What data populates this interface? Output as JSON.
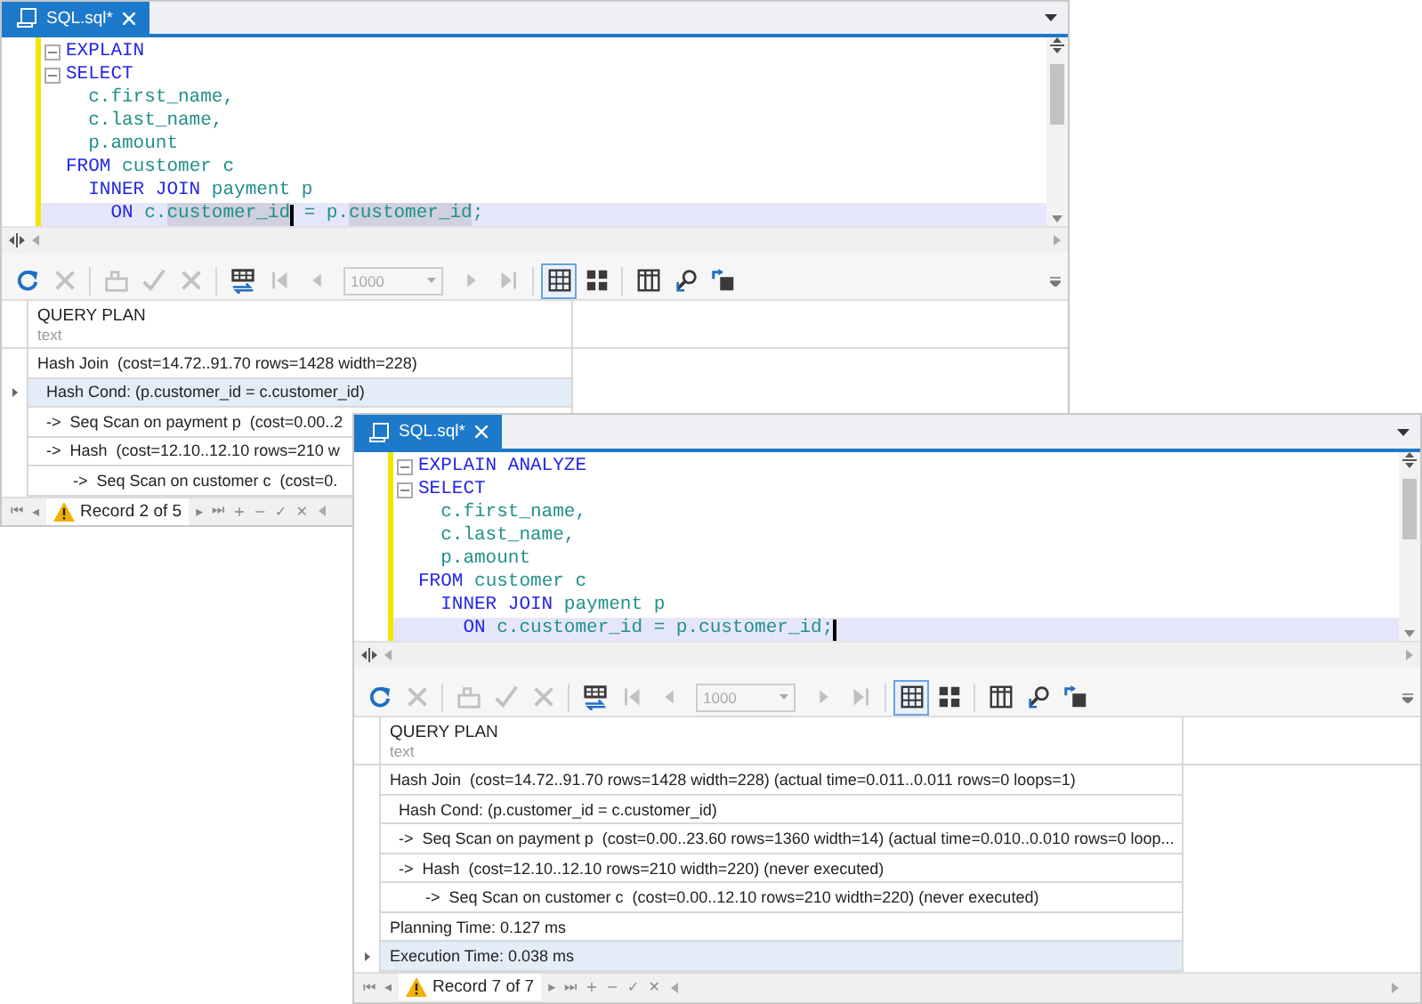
{
  "windows": [
    {
      "tab": {
        "title": "SQL.sql*",
        "selected": true
      },
      "code": [
        {
          "fold": true,
          "current": false,
          "tokens": [
            {
              "text": "EXPLAIN",
              "kind": "keyword",
              "caret": false
            }
          ]
        },
        {
          "fold": true,
          "current": false,
          "tokens": [
            {
              "text": "SELECT",
              "kind": "keyword",
              "caret": false
            }
          ]
        },
        {
          "fold": false,
          "current": false,
          "tokens": [
            {
              "text": "  c.first_name,",
              "kind": "ident",
              "caret": false
            }
          ]
        },
        {
          "fold": false,
          "current": false,
          "tokens": [
            {
              "text": "  c.last_name,",
              "kind": "ident",
              "caret": false
            }
          ]
        },
        {
          "fold": false,
          "current": false,
          "tokens": [
            {
              "text": "  p.amount",
              "kind": "ident",
              "caret": false
            }
          ]
        },
        {
          "fold": false,
          "current": false,
          "tokens": [
            {
              "text": "FROM",
              "kind": "keyword",
              "caret": false
            },
            {
              "text": " customer c",
              "kind": "ident",
              "caret": false
            }
          ]
        },
        {
          "fold": false,
          "current": false,
          "tokens": [
            {
              "text": "  INNER JOIN",
              "kind": "keyword",
              "caret": false
            },
            {
              "text": " payment p",
              "kind": "ident",
              "caret": false
            }
          ]
        },
        {
          "fold": false,
          "current": true,
          "tokens": [
            {
              "text": "    ON",
              "kind": "keyword",
              "caret": false
            },
            {
              "text": " c.",
              "kind": "ident",
              "caret": false
            },
            {
              "text": "customer_id",
              "kind": "match",
              "caret": true
            },
            {
              "text": " = p.",
              "kind": "ident",
              "caret": false
            },
            {
              "text": "customer_id",
              "kind": "match",
              "caret": false
            },
            {
              "text": ";",
              "kind": "ident",
              "caret": false
            }
          ]
        }
      ],
      "toolbar": [
        {
          "kind": "refresh",
          "disabled": false
        },
        {
          "kind": "stop",
          "disabled": true
        },
        {
          "kind": "separator"
        },
        {
          "kind": "apply",
          "disabled": true
        },
        {
          "kind": "check",
          "disabled": true
        },
        {
          "kind": "cancel",
          "disabled": true
        },
        {
          "kind": "separator"
        },
        {
          "kind": "fetch",
          "disabled": false
        },
        {
          "kind": "first",
          "disabled": true
        },
        {
          "kind": "prev",
          "disabled": true
        },
        {
          "kind": "page-size",
          "disabled": true,
          "value": "1000"
        },
        {
          "kind": "next",
          "disabled": true
        },
        {
          "kind": "last",
          "disabled": true
        },
        {
          "kind": "separator"
        },
        {
          "kind": "grid-view",
          "disabled": false,
          "selected": true
        },
        {
          "kind": "card-view",
          "disabled": false,
          "selected": false
        },
        {
          "kind": "separator"
        },
        {
          "kind": "columns",
          "disabled": false
        },
        {
          "kind": "find",
          "disabled": false
        },
        {
          "kind": "export",
          "disabled": false
        }
      ],
      "grid": {
        "column": {
          "title": "QUERY PLAN",
          "type": "text"
        },
        "rows": [
          {
            "text": "Hash Join  (cost=14.72..91.70 rows=1428 width=228)",
            "selected": false
          },
          {
            "text": "  Hash Cond: (p.customer_id = c.customer_id)",
            "selected": true
          },
          {
            "text": "  ->  Seq Scan on payment p  (cost=0.00..2",
            "selected": false
          },
          {
            "text": "  ->  Hash  (cost=12.10..12.10 rows=210 w",
            "selected": false
          },
          {
            "text": "        ->  Seq Scan on customer c  (cost=0.",
            "selected": false
          }
        ]
      },
      "navigator": {
        "left": [
          "⏮",
          "◂"
        ],
        "record": "Record 2 of 5",
        "right": [
          "▸",
          "⏭",
          "+",
          "−",
          "✓",
          "✕"
        ]
      }
    },
    {
      "tab": {
        "title": "SQL.sql*",
        "selected": true
      },
      "code": [
        {
          "fold": true,
          "current": false,
          "tokens": [
            {
              "text": "EXPLAIN ANALYZE",
              "kind": "keyword",
              "caret": false
            }
          ]
        },
        {
          "fold": true,
          "current": false,
          "tokens": [
            {
              "text": "SELECT",
              "kind": "keyword",
              "caret": false
            }
          ]
        },
        {
          "fold": false,
          "current": false,
          "tokens": [
            {
              "text": "  c.first_name,",
              "kind": "ident",
              "caret": false
            }
          ]
        },
        {
          "fold": false,
          "current": false,
          "tokens": [
            {
              "text": "  c.last_name,",
              "kind": "ident",
              "caret": false
            }
          ]
        },
        {
          "fold": false,
          "current": false,
          "tokens": [
            {
              "text": "  p.amount",
              "kind": "ident",
              "caret": false
            }
          ]
        },
        {
          "fold": false,
          "current": false,
          "tokens": [
            {
              "text": "FROM",
              "kind": "keyword",
              "caret": false
            },
            {
              "text": " customer c",
              "kind": "ident",
              "caret": false
            }
          ]
        },
        {
          "fold": false,
          "current": false,
          "tokens": [
            {
              "text": "  INNER JOIN",
              "kind": "keyword",
              "caret": false
            },
            {
              "text": " payment p",
              "kind": "ident",
              "caret": false
            }
          ]
        },
        {
          "fold": false,
          "current": true,
          "tokens": [
            {
              "text": "    ON",
              "kind": "keyword",
              "caret": false
            },
            {
              "text": " c.customer_id = p.customer_id;",
              "kind": "ident",
              "caret": true
            }
          ]
        }
      ],
      "toolbar": [
        {
          "kind": "refresh",
          "disabled": false
        },
        {
          "kind": "stop",
          "disabled": true
        },
        {
          "kind": "separator"
        },
        {
          "kind": "apply",
          "disabled": true
        },
        {
          "kind": "check",
          "disabled": true
        },
        {
          "kind": "cancel",
          "disabled": true
        },
        {
          "kind": "separator"
        },
        {
          "kind": "fetch",
          "disabled": false
        },
        {
          "kind": "first",
          "disabled": true
        },
        {
          "kind": "prev",
          "disabled": true
        },
        {
          "kind": "page-size",
          "disabled": true,
          "value": "1000"
        },
        {
          "kind": "next",
          "disabled": true
        },
        {
          "kind": "last",
          "disabled": true
        },
        {
          "kind": "separator"
        },
        {
          "kind": "grid-view",
          "disabled": false,
          "selected": true
        },
        {
          "kind": "card-view",
          "disabled": false,
          "selected": false
        },
        {
          "kind": "separator"
        },
        {
          "kind": "columns",
          "disabled": false
        },
        {
          "kind": "find",
          "disabled": false
        },
        {
          "kind": "export",
          "disabled": false
        }
      ],
      "grid": {
        "column": {
          "title": "QUERY PLAN",
          "type": "text"
        },
        "rows": [
          {
            "text": "Hash Join  (cost=14.72..91.70 rows=1428 width=228) (actual time=0.011..0.011 rows=0 loops=1)",
            "selected": false
          },
          {
            "text": "  Hash Cond: (p.customer_id = c.customer_id)",
            "selected": false
          },
          {
            "text": "  ->  Seq Scan on payment p  (cost=0.00..23.60 rows=1360 width=14) (actual time=0.010..0.010 rows=0 loop...",
            "selected": false
          },
          {
            "text": "  ->  Hash  (cost=12.10..12.10 rows=210 width=220) (never executed)",
            "selected": false
          },
          {
            "text": "        ->  Seq Scan on customer c  (cost=0.00..12.10 rows=210 width=220) (never executed)",
            "selected": false
          },
          {
            "text": "Planning Time: 0.127 ms",
            "selected": false
          },
          {
            "text": "Execution Time: 0.038 ms",
            "selected": true
          }
        ]
      },
      "navigator": {
        "left": [
          "⏮",
          "◂"
        ],
        "record": "Record 7 of 7",
        "right": [
          "▸",
          "⏭",
          "+",
          "−",
          "✓",
          "✕"
        ]
      }
    }
  ]
}
